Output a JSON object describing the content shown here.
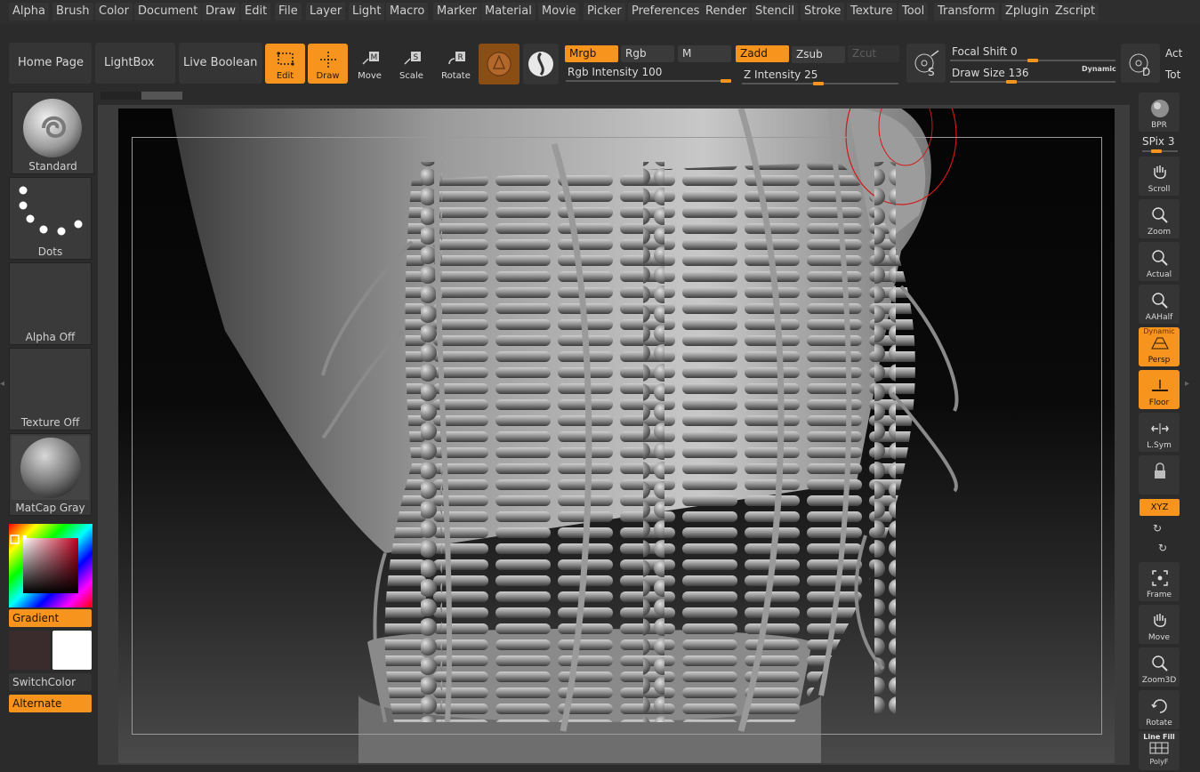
{
  "menu": [
    "Alpha",
    "Brush",
    "Color",
    "Document",
    "Draw",
    "Edit",
    "File",
    "Layer",
    "Light",
    "Macro",
    "Marker",
    "Material",
    "Movie",
    "Picker",
    "Preferences",
    "Render",
    "Stencil",
    "Stroke",
    "Texture",
    "Tool",
    "Transform",
    "Zplugin",
    "Zscript"
  ],
  "toolbar": {
    "home": "Home Page",
    "lightbox": "LightBox",
    "live_boolean": "Live Boolean",
    "edit": "Edit",
    "draw": "Draw",
    "move": "Move",
    "scale": "Scale",
    "rotate": "Rotate",
    "mrgb": "Mrgb",
    "rgb": "Rgb",
    "m": "M",
    "zadd": "Zadd",
    "zsub": "Zsub",
    "zcut": "Zcut",
    "rgb_intensity_label": "Rgb Intensity",
    "rgb_intensity_value": "100",
    "z_intensity_label": "Z Intensity",
    "z_intensity_value": "25",
    "focal_shift_label": "Focal Shift",
    "focal_shift_value": "0",
    "draw_size_label": "Draw Size",
    "draw_size_value": "136",
    "dynamic": "Dynamic",
    "act": "Act",
    "tot": "Tot",
    "s_btn": "S",
    "d_btn": "D"
  },
  "left_panel": {
    "brush": "Standard",
    "stroke": "Dots",
    "alpha": "Alpha Off",
    "texture": "Texture Off",
    "material": "MatCap Gray",
    "gradient": "Gradient",
    "switchcolor": "SwitchColor",
    "alternate": "Alternate"
  },
  "right_panel": {
    "bpr": "BPR",
    "spix_label": "SPix",
    "spix_value": "3",
    "scroll": "Scroll",
    "zoom": "Zoom",
    "actual": "Actual",
    "aahalf": "AAHalf",
    "dynamic_small": "Dynamic",
    "persp": "Persp",
    "floor": "Floor",
    "lsym": "L.Sym",
    "xyz": "XYZ",
    "frame": "Frame",
    "move": "Move",
    "zoom3d": "Zoom3D",
    "rotate": "Rotate",
    "line_fill": "Line Fill",
    "polyf": "PolyF"
  },
  "colors": {
    "accent": "#f7941d",
    "panel": "#353535",
    "bg": "#2b2b2b"
  }
}
